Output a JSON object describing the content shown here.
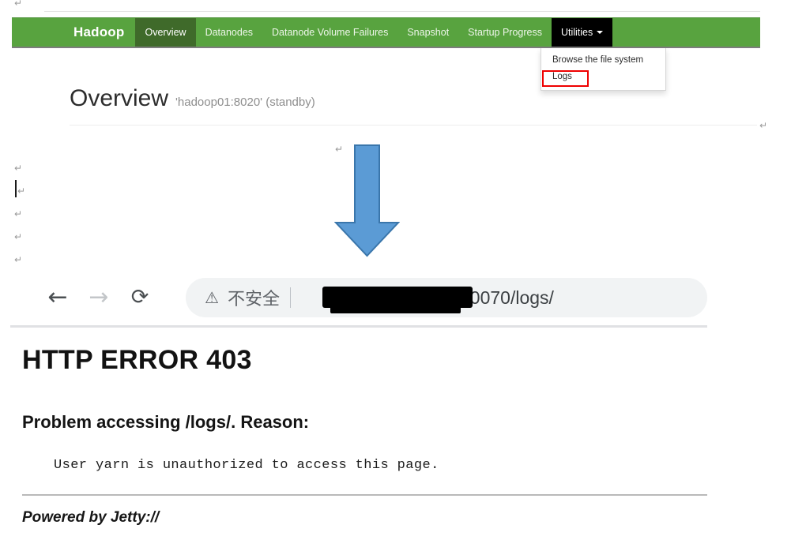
{
  "document": {
    "paragraph_marks": [
      "↵",
      "↵",
      "↵",
      "↵",
      "↵",
      "↵",
      "↵",
      "↵"
    ]
  },
  "hadoop_ui": {
    "brand": "Hadoop",
    "nav_items": [
      {
        "label": "Overview",
        "state": "active"
      },
      {
        "label": "Datanodes",
        "state": "normal"
      },
      {
        "label": "Datanode Volume Failures",
        "state": "normal"
      },
      {
        "label": "Snapshot",
        "state": "normal"
      },
      {
        "label": "Startup Progress",
        "state": "normal"
      },
      {
        "label": "Utilities",
        "state": "open"
      }
    ],
    "dropdown": {
      "items": [
        {
          "label": "Browse the file system",
          "highlighted": false
        },
        {
          "label": "Logs",
          "highlighted": true
        }
      ]
    },
    "page_heading": {
      "title": "Overview",
      "subtitle": "'hadoop01:8020' (standby)"
    },
    "colors": {
      "navbar_green": "#58a33f",
      "active_tab_green": "#3f6a2a",
      "open_tab_black": "#000000",
      "annotation_red": "#ef0000",
      "arrow_blue": "#5b9bd5",
      "arrow_blue_border": "#3a76ab"
    }
  },
  "annotation": {
    "arrow_icon": "down-arrow-icon",
    "direction": "down"
  },
  "browser": {
    "back_icon": "←",
    "forward_icon": "→",
    "reload_icon": "⟳",
    "security_icon": "⚠",
    "security_label": "不安全",
    "url_visible": ":50070/logs/",
    "url_redacted": true
  },
  "error_page": {
    "title": "HTTP ERROR 403",
    "reason_heading": "Problem accessing /logs/. Reason:",
    "reason_detail": "User yarn is unauthorized to access this page.",
    "footer": "Powered by Jetty://"
  }
}
